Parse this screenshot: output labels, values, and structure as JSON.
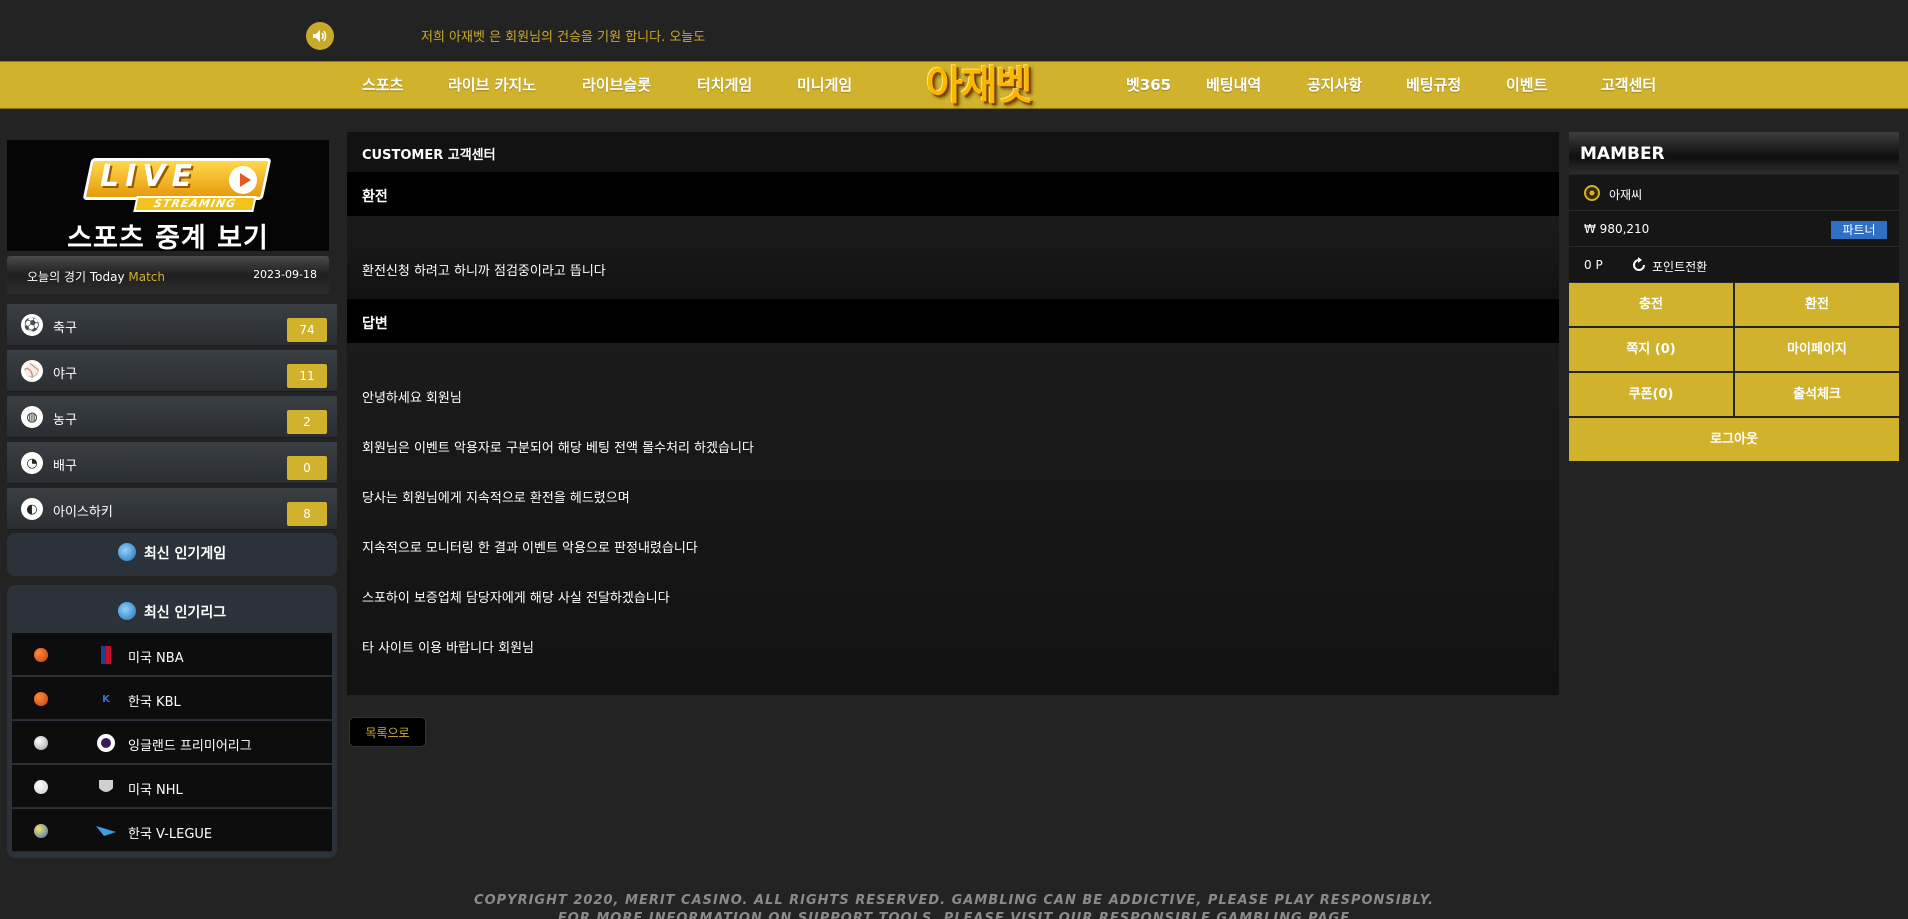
{
  "topbar": {
    "marquee": "저희 아재벳 은 회원님의 건승을 기원 합니다. 오늘도 좋"
  },
  "nav": {
    "left": [
      "스포츠",
      "라이브 카지노",
      "라이브슬롯",
      "터치게임",
      "미니게임"
    ],
    "logo": "아재벳",
    "right": [
      "벳365",
      "베팅내역",
      "공지사항",
      "베팅규정",
      "이벤트",
      "고객센터"
    ]
  },
  "sidebar": {
    "live_banner": {
      "line1": "LIVE",
      "line2": "STREAMING",
      "line3": "스포츠 중계 보기"
    },
    "today": {
      "label_kr": "오늘의 경기",
      "label_en1": "Today",
      "label_en2": "Match",
      "date": "2023-09-18"
    },
    "sports": [
      {
        "name": "축구",
        "count": "74",
        "icon": "soccer-icon"
      },
      {
        "name": "야구",
        "count": "11",
        "icon": "baseball-icon"
      },
      {
        "name": "농구",
        "count": "2",
        "icon": "basketball-icon"
      },
      {
        "name": "배구",
        "count": "0",
        "icon": "volleyball-icon"
      },
      {
        "name": "아이스하키",
        "count": "8",
        "icon": "hockey-icon"
      }
    ],
    "popular_games": "최신 인기게임",
    "popular_leagues": {
      "title": "최신 인기리그",
      "items": [
        {
          "name": "미국 NBA",
          "sport_icon": "basketball-icon",
          "logo": "nba-logo"
        },
        {
          "name": "한국 KBL",
          "sport_icon": "basketball-icon",
          "logo": "kbl-logo"
        },
        {
          "name": "잉글랜드 프리미어리그",
          "sport_icon": "soccer-icon",
          "logo": "epl-logo"
        },
        {
          "name": "미국 NHL",
          "sport_icon": "baseball-icon",
          "logo": "nhl-logo"
        },
        {
          "name": "한국 V-LEGUE",
          "sport_icon": "volleyball-icon",
          "logo": "vleague-logo"
        }
      ]
    }
  },
  "main": {
    "header": "CUSTOMER 고객센터",
    "question_title": "환전",
    "question_body": "환전신청 하려고 하니까 점검중이라고 뜹니다",
    "answer_title": "답변",
    "answer_lines": [
      "안녕하세요 회원님",
      "회원님은 이벤트 악용자로 구분되어 해당 베팅 전액 몰수처리 하겠습니다",
      "당사는 회원님에게 지속적으로 환전을 헤드렸으며",
      "지속적으로 모니터링 한 결과 이벤트 악용으로 판정내렸습니다",
      "스포하이 보증업체 담당자에게 해당 사실 전달하겠습니다",
      "타 사이트 이용 바랍니다 회원님"
    ],
    "back_button": "목록으로"
  },
  "member": {
    "title": "MAMBER",
    "username": "아재씨",
    "balance": "₩ 980,210",
    "partner": "파트너",
    "points": "0 P",
    "point_convert": "포인트전환",
    "buttons": {
      "deposit": "충전",
      "withdraw": "환전",
      "messages": "쪽지 (0)",
      "mypage": "마이페이지",
      "coupon": "쿠폰(0)",
      "attendance": "출석체크",
      "logout": "로그아웃"
    }
  },
  "footer": {
    "line1": "COPYRIGHT 2020, MERIT CASINO. ALL RIGHTS RESERVED. GAMBLING CAN BE ADDICTIVE, PLEASE PLAY RESPONSIBLY.",
    "line2": "FOR MORE INFORMATION ON SUPPORT TOOLS, PLEASE VISIT OUR RESPONSIBLE GAMBLING PAGE"
  },
  "colors": {
    "accent": "#d0b22d",
    "background": "#232323",
    "partner_badge": "#2f6fc4"
  }
}
